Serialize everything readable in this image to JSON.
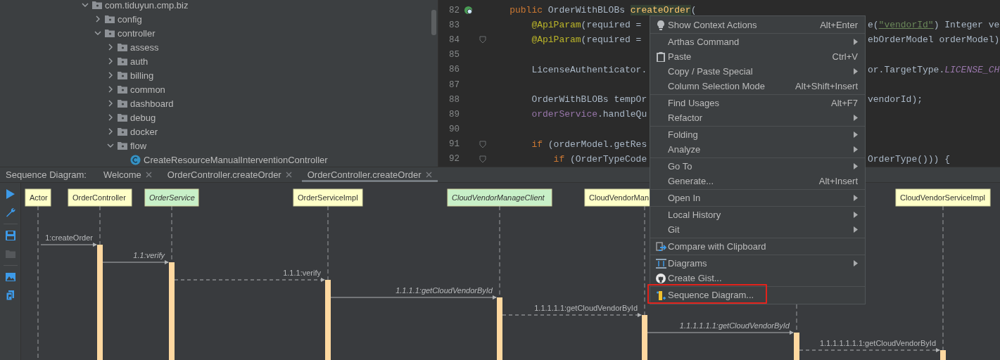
{
  "project_tree": {
    "items": [
      {
        "label": "com.tiduyun.cmp.biz",
        "kind": "package",
        "expanded": true,
        "children": [
          {
            "label": "config",
            "kind": "package",
            "expanded": false
          },
          {
            "label": "controller",
            "kind": "package",
            "expanded": true,
            "children": [
              {
                "label": "assess",
                "kind": "package",
                "expanded": false
              },
              {
                "label": "auth",
                "kind": "package",
                "expanded": false
              },
              {
                "label": "billing",
                "kind": "package",
                "expanded": false
              },
              {
                "label": "common",
                "kind": "package",
                "expanded": false
              },
              {
                "label": "dashboard",
                "kind": "package",
                "expanded": false
              },
              {
                "label": "debug",
                "kind": "package",
                "expanded": false
              },
              {
                "label": "docker",
                "kind": "package",
                "expanded": false
              },
              {
                "label": "flow",
                "kind": "package",
                "expanded": true,
                "children": [
                  {
                    "label": "CreateResourceManualInterventionController",
                    "kind": "class"
                  }
                ]
              }
            ]
          }
        ]
      }
    ]
  },
  "editor": {
    "lines": [
      {
        "number": "82",
        "kind": "method",
        "left": [
          {
            "text": "public",
            "kind": "keyword"
          },
          {
            "text": " OrderWithBLOBs "
          },
          {
            "text": "createOrder",
            "kind": "method"
          },
          {
            "text": "("
          }
        ]
      },
      {
        "number": "83",
        "left": [
          {
            "text": "@ApiParam",
            "kind": "annotation"
          },
          {
            "text": "(required = "
          }
        ],
        "right": [
          {
            "text": "e("
          },
          {
            "text": "\"vendorId\"",
            "kind": "string"
          },
          {
            "text": ") Integer ve"
          }
        ]
      },
      {
        "number": "84",
        "kind": "fold",
        "left": [
          {
            "text": "@ApiParam",
            "kind": "annotation"
          },
          {
            "text": "(required = "
          }
        ],
        "right": [
          {
            "text": "ebOrderModel orderModel)"
          }
        ]
      },
      {
        "number": "85"
      },
      {
        "number": "86",
        "left": [
          {
            "text": "LicenseAuthenticator."
          }
        ],
        "right": [
          {
            "text": "or.TargetType."
          },
          {
            "text": "LICENSE_CH",
            "kind": "constant"
          }
        ]
      },
      {
        "number": "87"
      },
      {
        "number": "88",
        "left": [
          {
            "text": "OrderWithBLOBs tempOr"
          }
        ],
        "right": [
          {
            "text": "vendorId);"
          }
        ]
      },
      {
        "number": "89",
        "left": [
          {
            "text": "orderService",
            "kind": "field"
          },
          {
            "text": ".handleQu"
          }
        ]
      },
      {
        "number": "90"
      },
      {
        "number": "91",
        "kind": "fold",
        "left": [
          {
            "text": "if",
            "kind": "keyword"
          },
          {
            "text": " (orderModel.getRes"
          }
        ]
      },
      {
        "number": "92",
        "kind": "fold",
        "left": [
          {
            "text": "if",
            "kind": "keyword"
          },
          {
            "text": " (OrderTypeCode"
          }
        ],
        "right": [
          {
            "text": "OrderType())) {"
          }
        ]
      }
    ]
  },
  "diagram_tabs": {
    "label": "Sequence Diagram:",
    "tabs": [
      {
        "label": "Welcome",
        "selected": false
      },
      {
        "label": "OrderController.createOrder",
        "selected": false
      },
      {
        "label": "OrderController.createOrder",
        "selected": true
      }
    ]
  },
  "diagram_toolbar": [
    {
      "kind": "run",
      "disabled": false
    },
    {
      "kind": "settings",
      "disabled": false
    },
    {
      "kind": "save",
      "disabled": false
    },
    {
      "kind": "open",
      "disabled": true
    },
    {
      "kind": "image",
      "disabled": false
    },
    {
      "kind": "export",
      "disabled": false
    }
  ],
  "sequence_diagram": {
    "participants": [
      {
        "name": "Actor",
        "kind": "class"
      },
      {
        "name": "OrderController",
        "kind": "class"
      },
      {
        "name": "OrderService",
        "kind": "interface"
      },
      {
        "name": "OrderServiceImpl",
        "kind": "class"
      },
      {
        "name": "CloudVendorManageClient",
        "kind": "interface"
      },
      {
        "name": "CloudVendorMan",
        "kind": "class"
      },
      {
        "kind": "lifeline"
      },
      {
        "name": "CloudVendorServiceImpl",
        "kind": "class"
      }
    ],
    "messages": [
      {
        "label": "1:createOrder",
        "kind": "call",
        "italic": false
      },
      {
        "label": "1.1:verify",
        "kind": "call",
        "italic": true
      },
      {
        "label": "1.1.1:verify",
        "kind": "dashed",
        "italic": false
      },
      {
        "label": "1.1.1.1:getCloudVendorById",
        "kind": "call",
        "italic": true
      },
      {
        "label": "1.1.1.1.1:getCloudVendorById",
        "kind": "dashed",
        "italic": false
      },
      {
        "label": "1.1.1.1.1.1:getCloudVendorById",
        "kind": "call",
        "italic": true
      },
      {
        "label": "1.1.1.1.1.1.1:getCloudVendorById",
        "kind": "dashed",
        "italic": false
      }
    ]
  },
  "context_menu": {
    "groups": [
      {
        "items": [
          {
            "label": "Show Context Actions",
            "shortcut": "Alt+Enter",
            "submenu": false,
            "outlined": false
          }
        ]
      },
      {
        "items": [
          {
            "label": "Arthas Command",
            "submenu": true,
            "outlined": false
          },
          {
            "label": "Paste",
            "shortcut": "Ctrl+V",
            "submenu": false,
            "outlined": false
          },
          {
            "label": "Copy / Paste Special",
            "submenu": true,
            "outlined": false
          },
          {
            "label": "Column Selection Mode",
            "shortcut": "Alt+Shift+Insert",
            "submenu": false,
            "outlined": false
          }
        ]
      },
      {
        "items": [
          {
            "label": "Find Usages",
            "shortcut": "Alt+F7",
            "submenu": false,
            "outlined": false
          },
          {
            "label": "Refactor",
            "submenu": true,
            "outlined": false
          }
        ]
      },
      {
        "items": [
          {
            "label": "Folding",
            "submenu": true,
            "outlined": false
          },
          {
            "label": "Analyze",
            "submenu": true,
            "outlined": false
          }
        ]
      },
      {
        "items": [
          {
            "label": "Go To",
            "submenu": true,
            "outlined": false
          },
          {
            "label": "Generate...",
            "shortcut": "Alt+Insert",
            "submenu": false,
            "outlined": false
          }
        ]
      },
      {
        "items": [
          {
            "label": "Open In",
            "submenu": true,
            "outlined": false
          }
        ]
      },
      {
        "items": [
          {
            "label": "Local History",
            "submenu": true,
            "outlined": false
          },
          {
            "label": "Git",
            "submenu": true,
            "outlined": false
          }
        ]
      },
      {
        "items": [
          {
            "label": "Compare with Clipboard",
            "submenu": false,
            "outlined": false
          }
        ]
      },
      {
        "items": [
          {
            "label": "Diagrams",
            "submenu": true,
            "outlined": false
          },
          {
            "label": "Create Gist...",
            "submenu": false,
            "outlined": false
          }
        ]
      },
      {
        "items": [
          {
            "label": "Sequence Diagram...",
            "submenu": false,
            "outlined": true
          }
        ]
      }
    ]
  }
}
